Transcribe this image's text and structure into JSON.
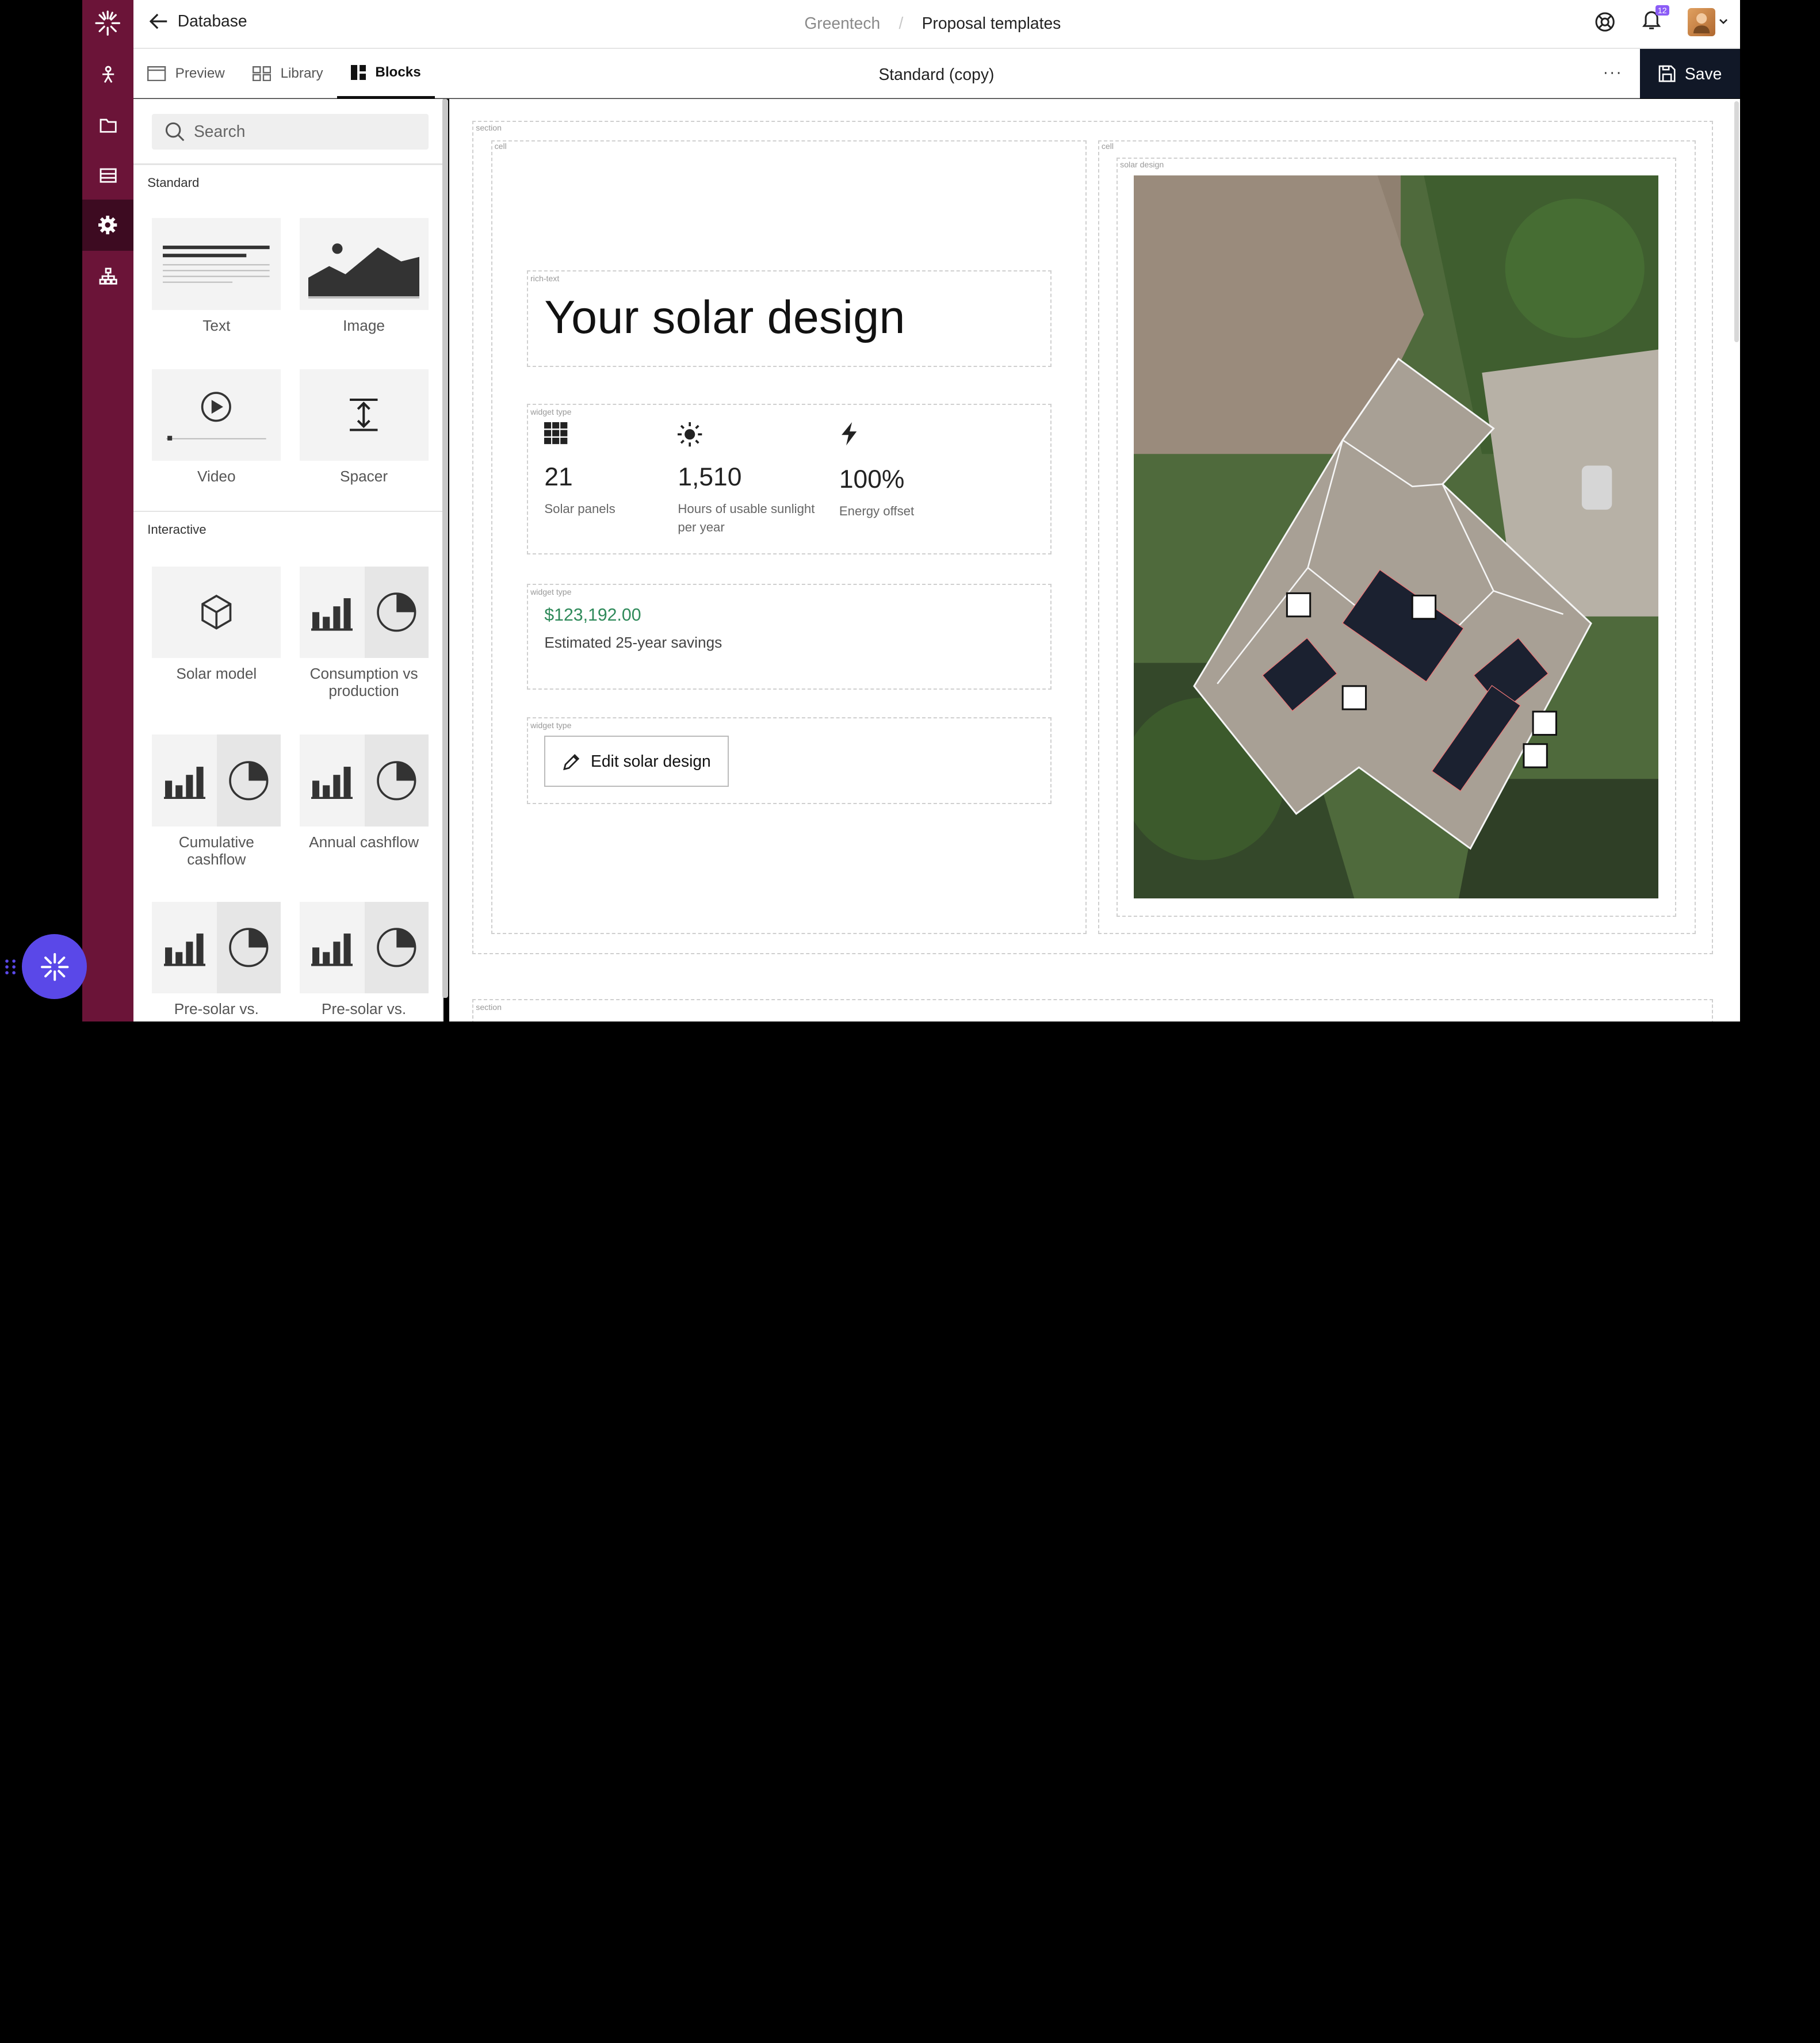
{
  "header": {
    "back_label": "Database",
    "breadcrumb": [
      "Greentech",
      "Proposal templates"
    ],
    "notifications_count": "12"
  },
  "toolbar": {
    "tabs": [
      {
        "label": "Preview",
        "icon": "preview-icon"
      },
      {
        "label": "Library",
        "icon": "library-icon"
      },
      {
        "label": "Blocks",
        "icon": "blocks-icon",
        "active": true
      }
    ],
    "document_title": "Standard (copy)",
    "more_label": "···",
    "save_label": "Save"
  },
  "sidebar": {
    "search_placeholder": "Search",
    "sections": [
      {
        "title": "Standard",
        "blocks": [
          "Text",
          "Image",
          "Video",
          "Spacer"
        ]
      },
      {
        "title": "Interactive",
        "blocks": [
          "Solar model",
          "Consumption vs production",
          "Cumulative cashflow",
          "Annual cashflow",
          "Pre-solar vs.",
          "Pre-solar vs."
        ]
      }
    ]
  },
  "canvas": {
    "labels": {
      "section": "section",
      "cell": "cell",
      "solar_design": "solar design",
      "rich_text": "rich-text",
      "widget_type": "widget type"
    },
    "hero_title": "Your solar design",
    "stats": [
      {
        "icon": "panels-grid-icon",
        "value": "21",
        "caption": "Solar panels"
      },
      {
        "icon": "sun-icon",
        "value": "1,510",
        "caption": "Hours of usable sunlight per year"
      },
      {
        "icon": "lightning-icon",
        "value": "100%",
        "caption": "Energy offset"
      }
    ],
    "savings": {
      "amount": "$123,192.00",
      "caption": "Estimated 25-year savings"
    },
    "edit_button": "Edit solar design"
  },
  "colors": {
    "rail": "#6b1438",
    "rail_active": "#3d0b21",
    "save_button": "#111827",
    "money": "#2f8a5a",
    "fab": "#5a48e8"
  }
}
